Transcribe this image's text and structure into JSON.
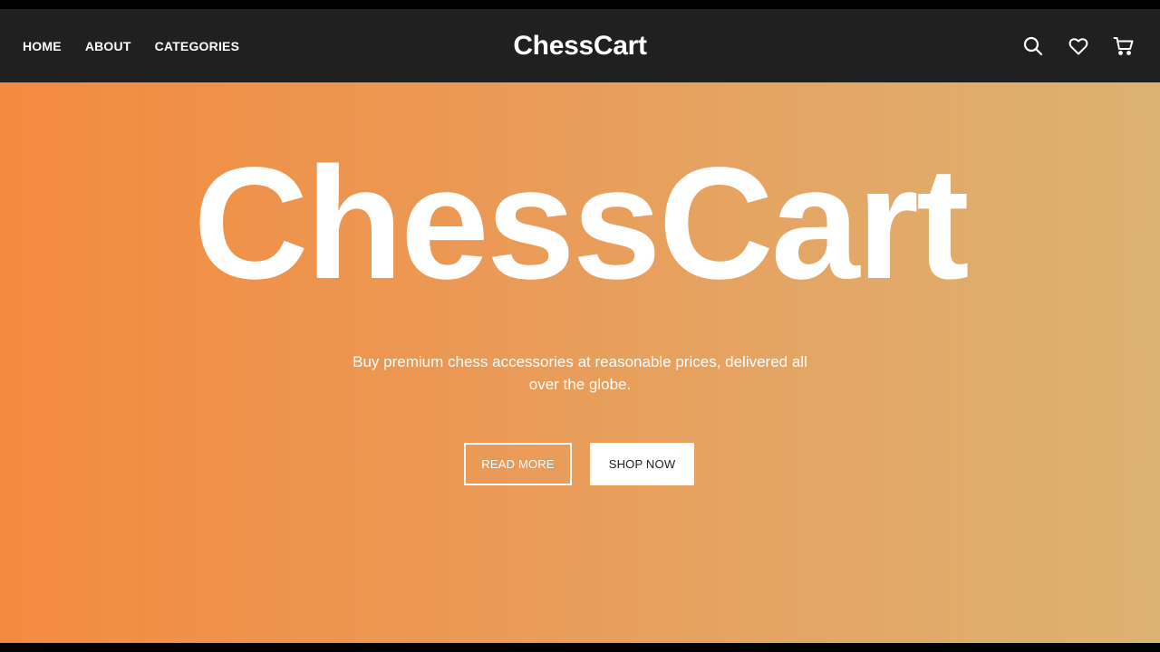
{
  "navbar": {
    "links": [
      "HOME",
      "ABOUT",
      "CATEGORIES"
    ],
    "brand": "ChessCart",
    "icons": [
      "search-icon",
      "heart-icon",
      "cart-icon"
    ]
  },
  "hero": {
    "title": "ChessCart",
    "subtitle": "Buy premium chess accessories at reasonable prices, delivered all over the globe.",
    "read_more_label": "READ MORE",
    "shop_now_label": "SHOP NOW"
  },
  "colors": {
    "navbar_bg": "#202020",
    "gradient_start": "#f48a40",
    "gradient_end": "#dcb272",
    "text": "#ffffff"
  }
}
